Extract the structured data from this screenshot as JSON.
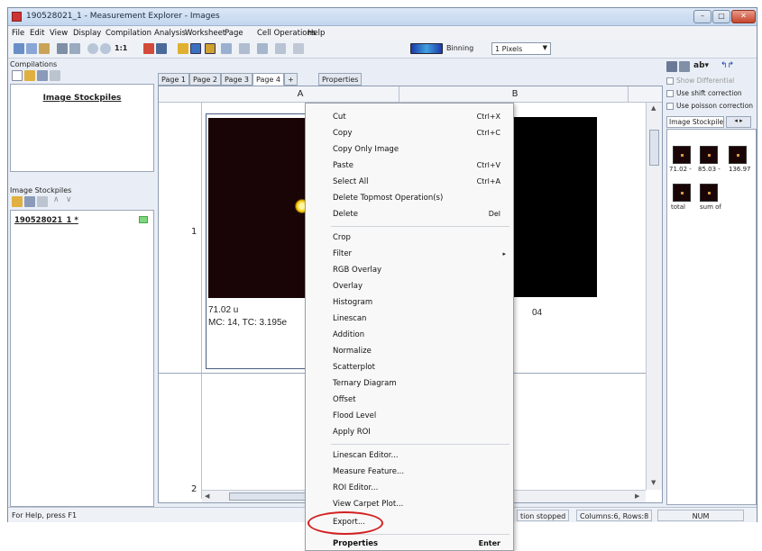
{
  "window": {
    "title": "190528021_1 - Measurement Explorer - Images",
    "controls": {
      "minimize": "–",
      "maximize": "□",
      "close": "✕"
    }
  },
  "menubar": [
    "File",
    "Edit",
    "View",
    "Display",
    "Compilation",
    "Analysis",
    "Worksheet",
    "Page",
    "Cell Operations",
    "Help"
  ],
  "toolbar": {
    "icons": [
      "cut-icon",
      "copy-icon",
      "paste-icon",
      "print-icon",
      "print-preview-icon",
      "zoom-in-icon",
      "zoom-out-icon",
      "zoom-1-1-icon",
      "chart-icon",
      "grid-icon",
      "image-mode-icon",
      "image-mode-2-icon",
      "mw-icon",
      "linescan-icon",
      "crop-icon",
      "color-scale-icon"
    ],
    "zoom_label": "1:1",
    "binning_label": "Binning",
    "binning_value": "1 Pixels"
  },
  "left_panel": {
    "compilations_label": "Compilations",
    "compilations_heading": "Image Stockpiles",
    "stockpiles_label": "Image Stockpiles",
    "stockpile_item": "190528021_1 *"
  },
  "tabs": [
    "Page 1",
    "Page 2",
    "Page 3",
    "Page 4",
    "+",
    "Properties"
  ],
  "grid": {
    "col_a": "A",
    "col_b": "B",
    "row1": "1",
    "row2": "2",
    "cell_a_caption1": "71.02 u",
    "cell_a_caption2": "MC:    14, TC: 3.195e",
    "cell_b_caption": "04"
  },
  "right_panel": {
    "checkboxes": [
      "Show Differential",
      "Use shift correction",
      "Use poisson correction"
    ],
    "tab_label": "Image Stockpile",
    "tab_btn": "◂ ▸",
    "thumb_labels": [
      "71.02 -",
      "85.03 -",
      "136.97",
      "total",
      "sum of"
    ]
  },
  "statusbar": {
    "help": "For Help, press F1",
    "state": "tion stopped",
    "columns": "Columns:6, Rows:8",
    "num": "NUM"
  },
  "context_menu": {
    "items": [
      {
        "label": "Cut",
        "key": "Ctrl+X"
      },
      {
        "label": "Copy",
        "key": "Ctrl+C"
      },
      {
        "label": "Copy Only Image",
        "key": ""
      },
      {
        "label": "Paste",
        "key": "Ctrl+V"
      },
      {
        "label": "Select All",
        "key": "Ctrl+A"
      },
      {
        "label": "Delete Topmost Operation(s)",
        "key": ""
      },
      {
        "label": "Delete",
        "key": "Del"
      },
      {
        "label": "Crop",
        "key": ""
      },
      {
        "label": "Filter",
        "key": ""
      },
      {
        "label": "RGB Overlay",
        "key": ""
      },
      {
        "label": "Overlay",
        "key": ""
      },
      {
        "label": "Histogram",
        "key": ""
      },
      {
        "label": "Linescan",
        "key": ""
      },
      {
        "label": "Addition",
        "key": ""
      },
      {
        "label": "Normalize",
        "key": ""
      },
      {
        "label": "Scatterplot",
        "key": ""
      },
      {
        "label": "Ternary Diagram",
        "key": ""
      },
      {
        "label": "Offset",
        "key": ""
      },
      {
        "label": "Flood Level",
        "key": ""
      },
      {
        "label": "Apply ROI",
        "key": ""
      },
      {
        "label": "Linescan Editor...",
        "key": ""
      },
      {
        "label": "Measure Feature...",
        "key": ""
      },
      {
        "label": "ROI Editor...",
        "key": ""
      },
      {
        "label": "View Carpet Plot...",
        "key": ""
      },
      {
        "label": "Export...",
        "key": ""
      },
      {
        "label": "Properties",
        "key": "Enter"
      }
    ],
    "submenu_arrow": "▸"
  },
  "colors": {
    "highlight_circle": "#d42020",
    "title_gradient": "#c2d6ee",
    "image_bg": "#1a0506"
  }
}
